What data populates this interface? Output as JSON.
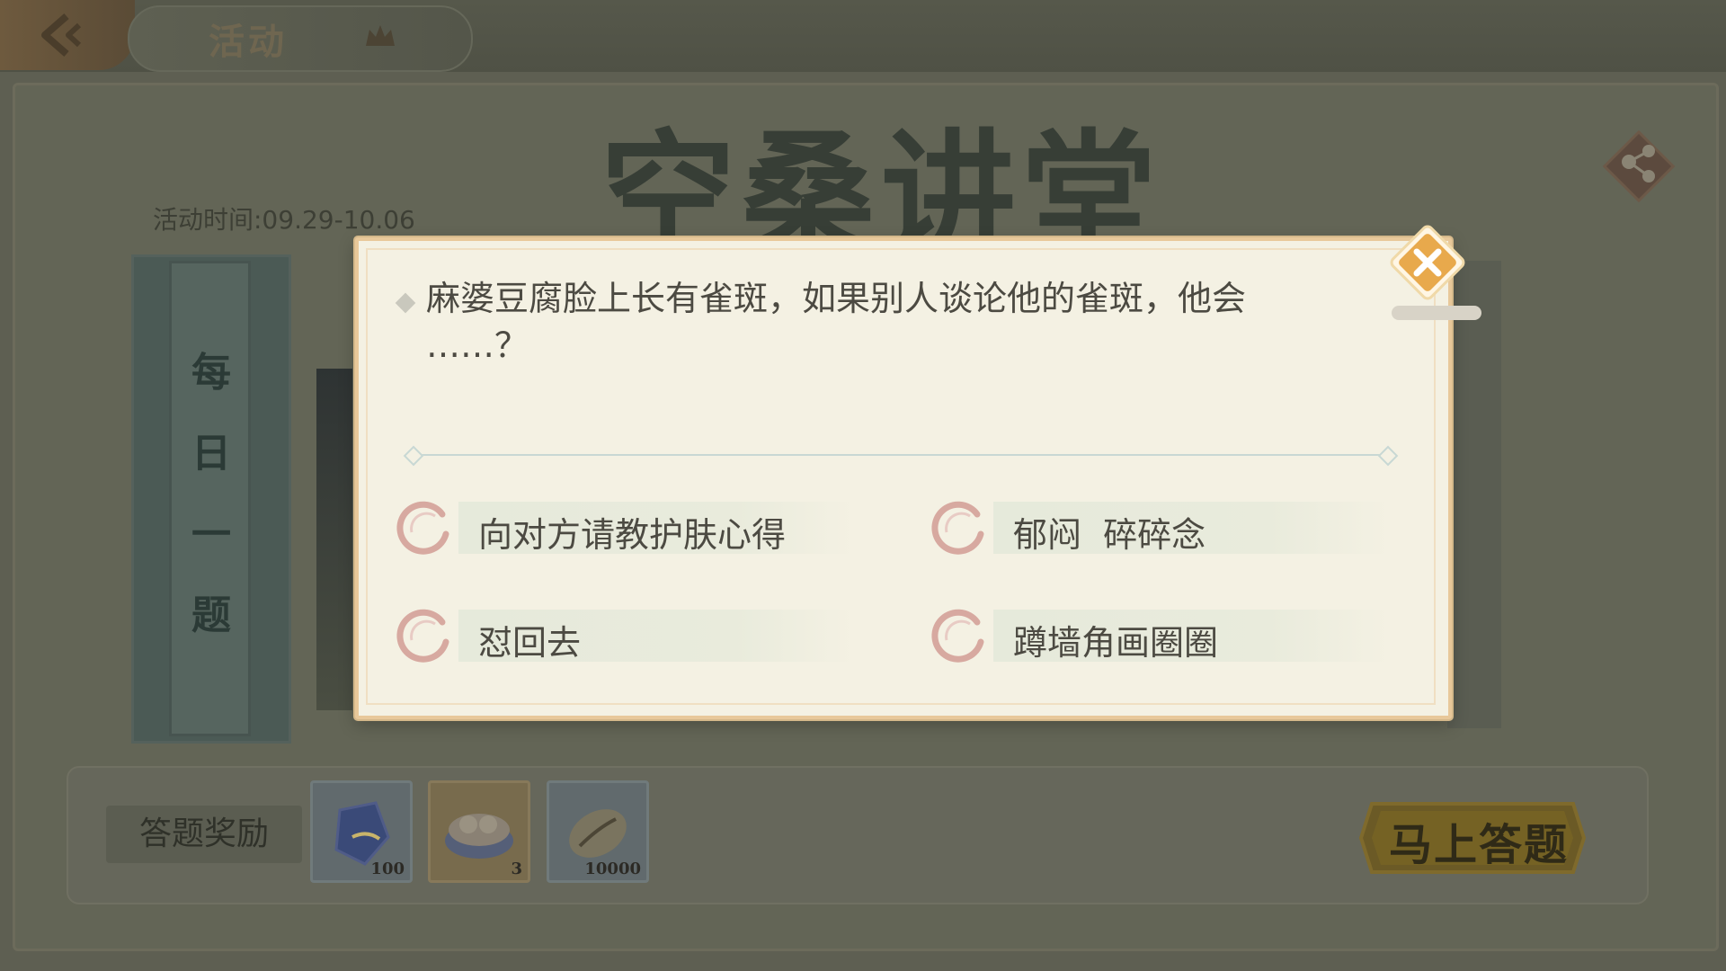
{
  "top_bar": {
    "title": "活动"
  },
  "background": {
    "banner_title": "空桑讲堂",
    "activity_time": "活动时间:09.29-10.06",
    "daily_label": [
      "每",
      "日",
      "一",
      "题"
    ]
  },
  "rewards": {
    "label": "答题奖励",
    "items": [
      {
        "icon": "jade-crystal-icon",
        "count": "100"
      },
      {
        "icon": "food-spirit-bowl-icon",
        "count": "3"
      },
      {
        "icon": "shell-coin-icon",
        "count": "10000"
      }
    ],
    "start_button": "马上答题"
  },
  "quiz": {
    "question_line1": "麻婆豆腐脸上长有雀斑，如果别人谈论他的雀斑，他会",
    "question_line2": "……？",
    "options": [
      {
        "label": "向对方请教护肤心得"
      },
      {
        "label": "郁闷  碎碎念"
      },
      {
        "label": "怼回去"
      },
      {
        "label": "蹲墙角画圈圈"
      }
    ]
  },
  "colors": {
    "modal_bg": "#f4f1e3",
    "modal_border": "#e8c89a",
    "option_ring": "#d7a9a0",
    "close_button": "#e8a94c"
  }
}
